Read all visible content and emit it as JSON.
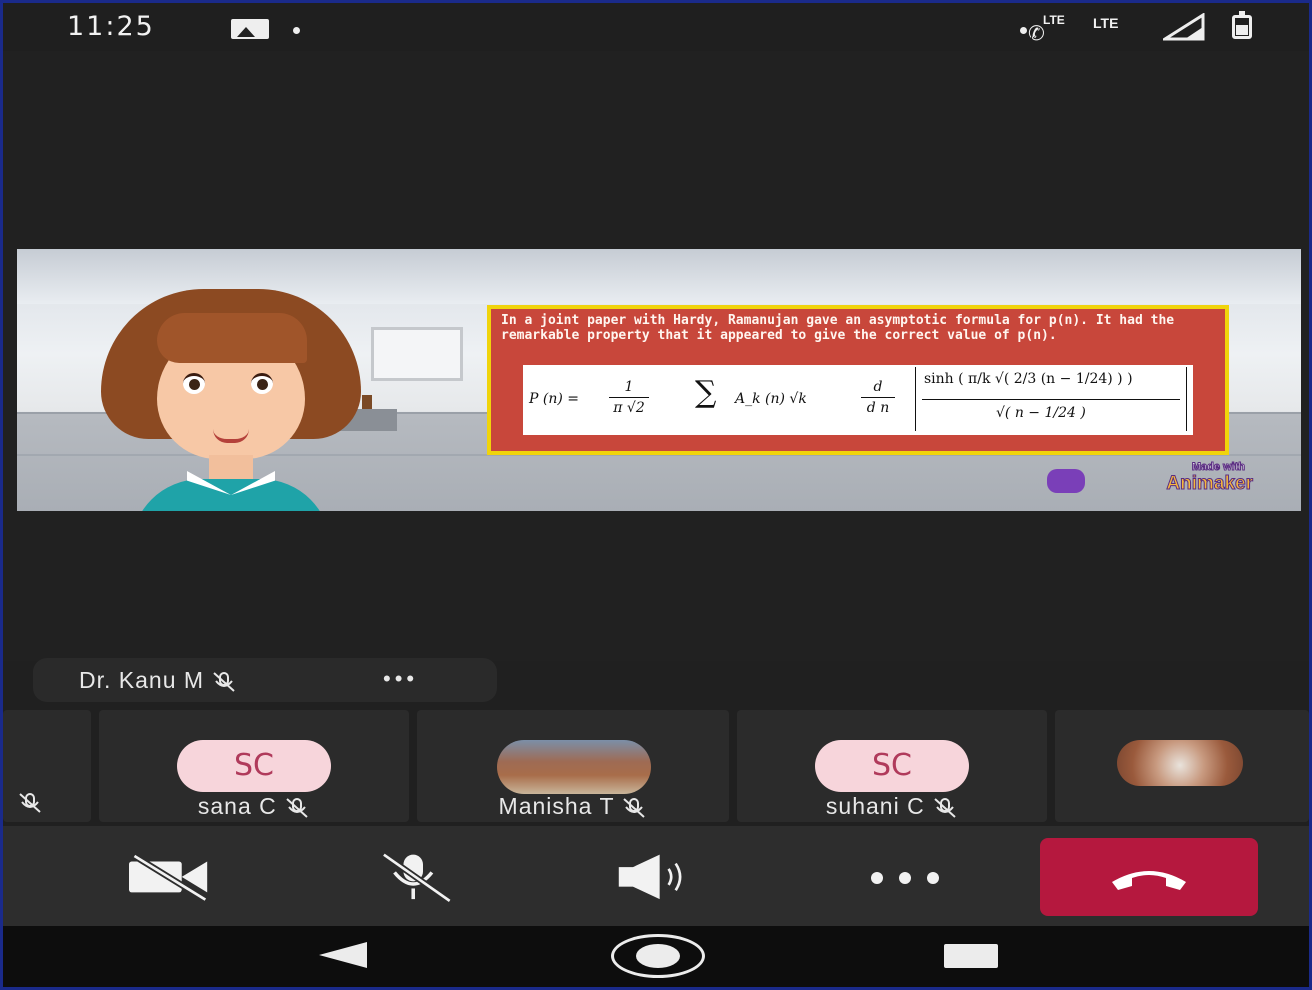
{
  "status_bar": {
    "time": "11:25",
    "network_labels": [
      "LTE",
      "LTE"
    ],
    "icons": [
      "image-notification-icon",
      "dot-icon",
      "volte-call-icon",
      "signal-icon",
      "battery-icon"
    ]
  },
  "shared_screen": {
    "slide_text": "In a joint paper with Hardy, Ramanujan gave an asymptotic formula for p(n). It had the remarkable property that it appeared to give the correct value of p(n).",
    "formula": {
      "lhs": "P (n) =",
      "frac_num": "1",
      "frac_den": "π √2",
      "sum_symbol": "∑",
      "term": "A_k (n) √k",
      "deriv_num": "d",
      "deriv_den": "d n",
      "big_num": "sinh ( π/k √( 2/3 (n − 1/24) ) )",
      "big_den": "√( n − 1/24 )"
    },
    "watermark_line1": "Made with",
    "watermark_line2": "Animaker"
  },
  "speaker": {
    "name": "Dr. Kanu M",
    "more_label": "•••"
  },
  "participants": [
    {
      "name": "",
      "initials": "",
      "muted": true,
      "kind": "partial"
    },
    {
      "name": "sana C",
      "initials": "SC",
      "muted": true,
      "kind": "initials"
    },
    {
      "name": "Manisha T",
      "initials": "",
      "muted": true,
      "kind": "photo"
    },
    {
      "name": "suhani C",
      "initials": "SC",
      "muted": true,
      "kind": "initials"
    },
    {
      "name": "",
      "initials": "",
      "muted": false,
      "kind": "photo"
    }
  ],
  "controls": {
    "more_label": "•••",
    "buttons": [
      "camera-off-icon",
      "mic-off-icon",
      "speaker-icon",
      "more-icon",
      "end-call-icon"
    ]
  },
  "colors": {
    "end_call": "#b5183e",
    "initials_bg": "#f7d5db",
    "initials_text": "#b03a5b",
    "slide_bg": "#c8473b",
    "slide_border": "#f0d40b"
  }
}
